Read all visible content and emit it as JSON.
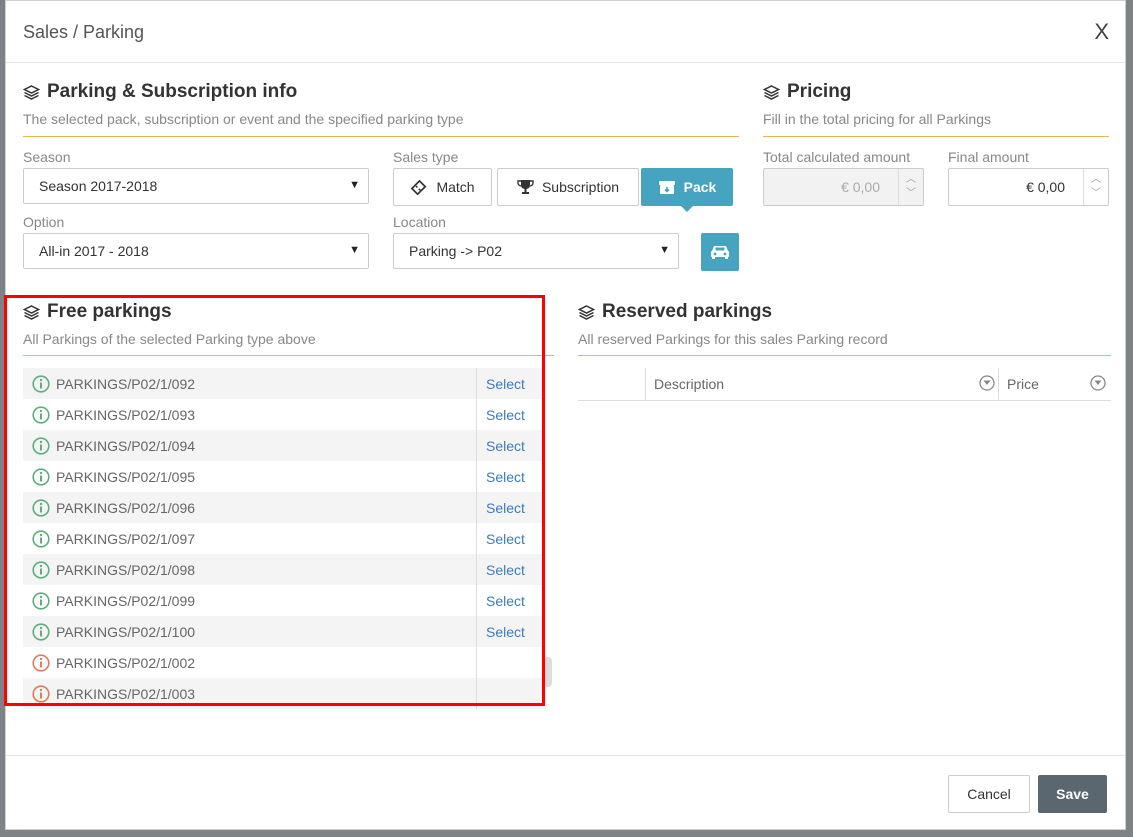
{
  "header": {
    "title": "Sales / Parking",
    "close_label": "X"
  },
  "parking_info": {
    "title": "Parking & Subscription info",
    "subtitle": "The selected pack, subscription or event and the specified parking type",
    "season_label": "Season",
    "season_value": "Season 2017-2018",
    "sales_type_label": "Sales type",
    "sales_types": [
      "Match",
      "Subscription",
      "Pack"
    ],
    "sales_type_selected": "Pack",
    "option_label": "Option",
    "option_value": "All-in 2017 - 2018",
    "location_label": "Location",
    "location_value": "Parking -> P02"
  },
  "pricing": {
    "title": "Pricing",
    "subtitle": "Fill in the total pricing for all Parkings",
    "total_label": "Total calculated amount",
    "total_value": "€ 0,00",
    "final_label": "Final amount",
    "final_value": "€ 0,00"
  },
  "free_parkings": {
    "title": "Free parkings",
    "subtitle": "All Parkings of the selected Parking type above",
    "select_label": "Select",
    "rows": [
      {
        "code": "PARKINGS/P02/1/092",
        "status": "available"
      },
      {
        "code": "PARKINGS/P02/1/093",
        "status": "available"
      },
      {
        "code": "PARKINGS/P02/1/094",
        "status": "available"
      },
      {
        "code": "PARKINGS/P02/1/095",
        "status": "available"
      },
      {
        "code": "PARKINGS/P02/1/096",
        "status": "available"
      },
      {
        "code": "PARKINGS/P02/1/097",
        "status": "available"
      },
      {
        "code": "PARKINGS/P02/1/098",
        "status": "available"
      },
      {
        "code": "PARKINGS/P02/1/099",
        "status": "available"
      },
      {
        "code": "PARKINGS/P02/1/100",
        "status": "available"
      },
      {
        "code": "PARKINGS/P02/1/002",
        "status": "unavailable"
      },
      {
        "code": "PARKINGS/P02/1/003",
        "status": "unavailable"
      }
    ]
  },
  "reserved_parkings": {
    "title": "Reserved parkings",
    "subtitle": "All reserved Parkings for this sales Parking record",
    "columns": [
      "Description",
      "Price"
    ]
  },
  "footer": {
    "cancel_label": "Cancel",
    "save_label": "Save"
  },
  "colors": {
    "accent": "#47a4c0",
    "rule": "#e8b54a",
    "link": "#3b7bbf",
    "available_icon": "#5cae7a",
    "unavailable_icon": "#e07b5b",
    "save_bg": "#5a6670",
    "highlight": "#ff0000"
  }
}
